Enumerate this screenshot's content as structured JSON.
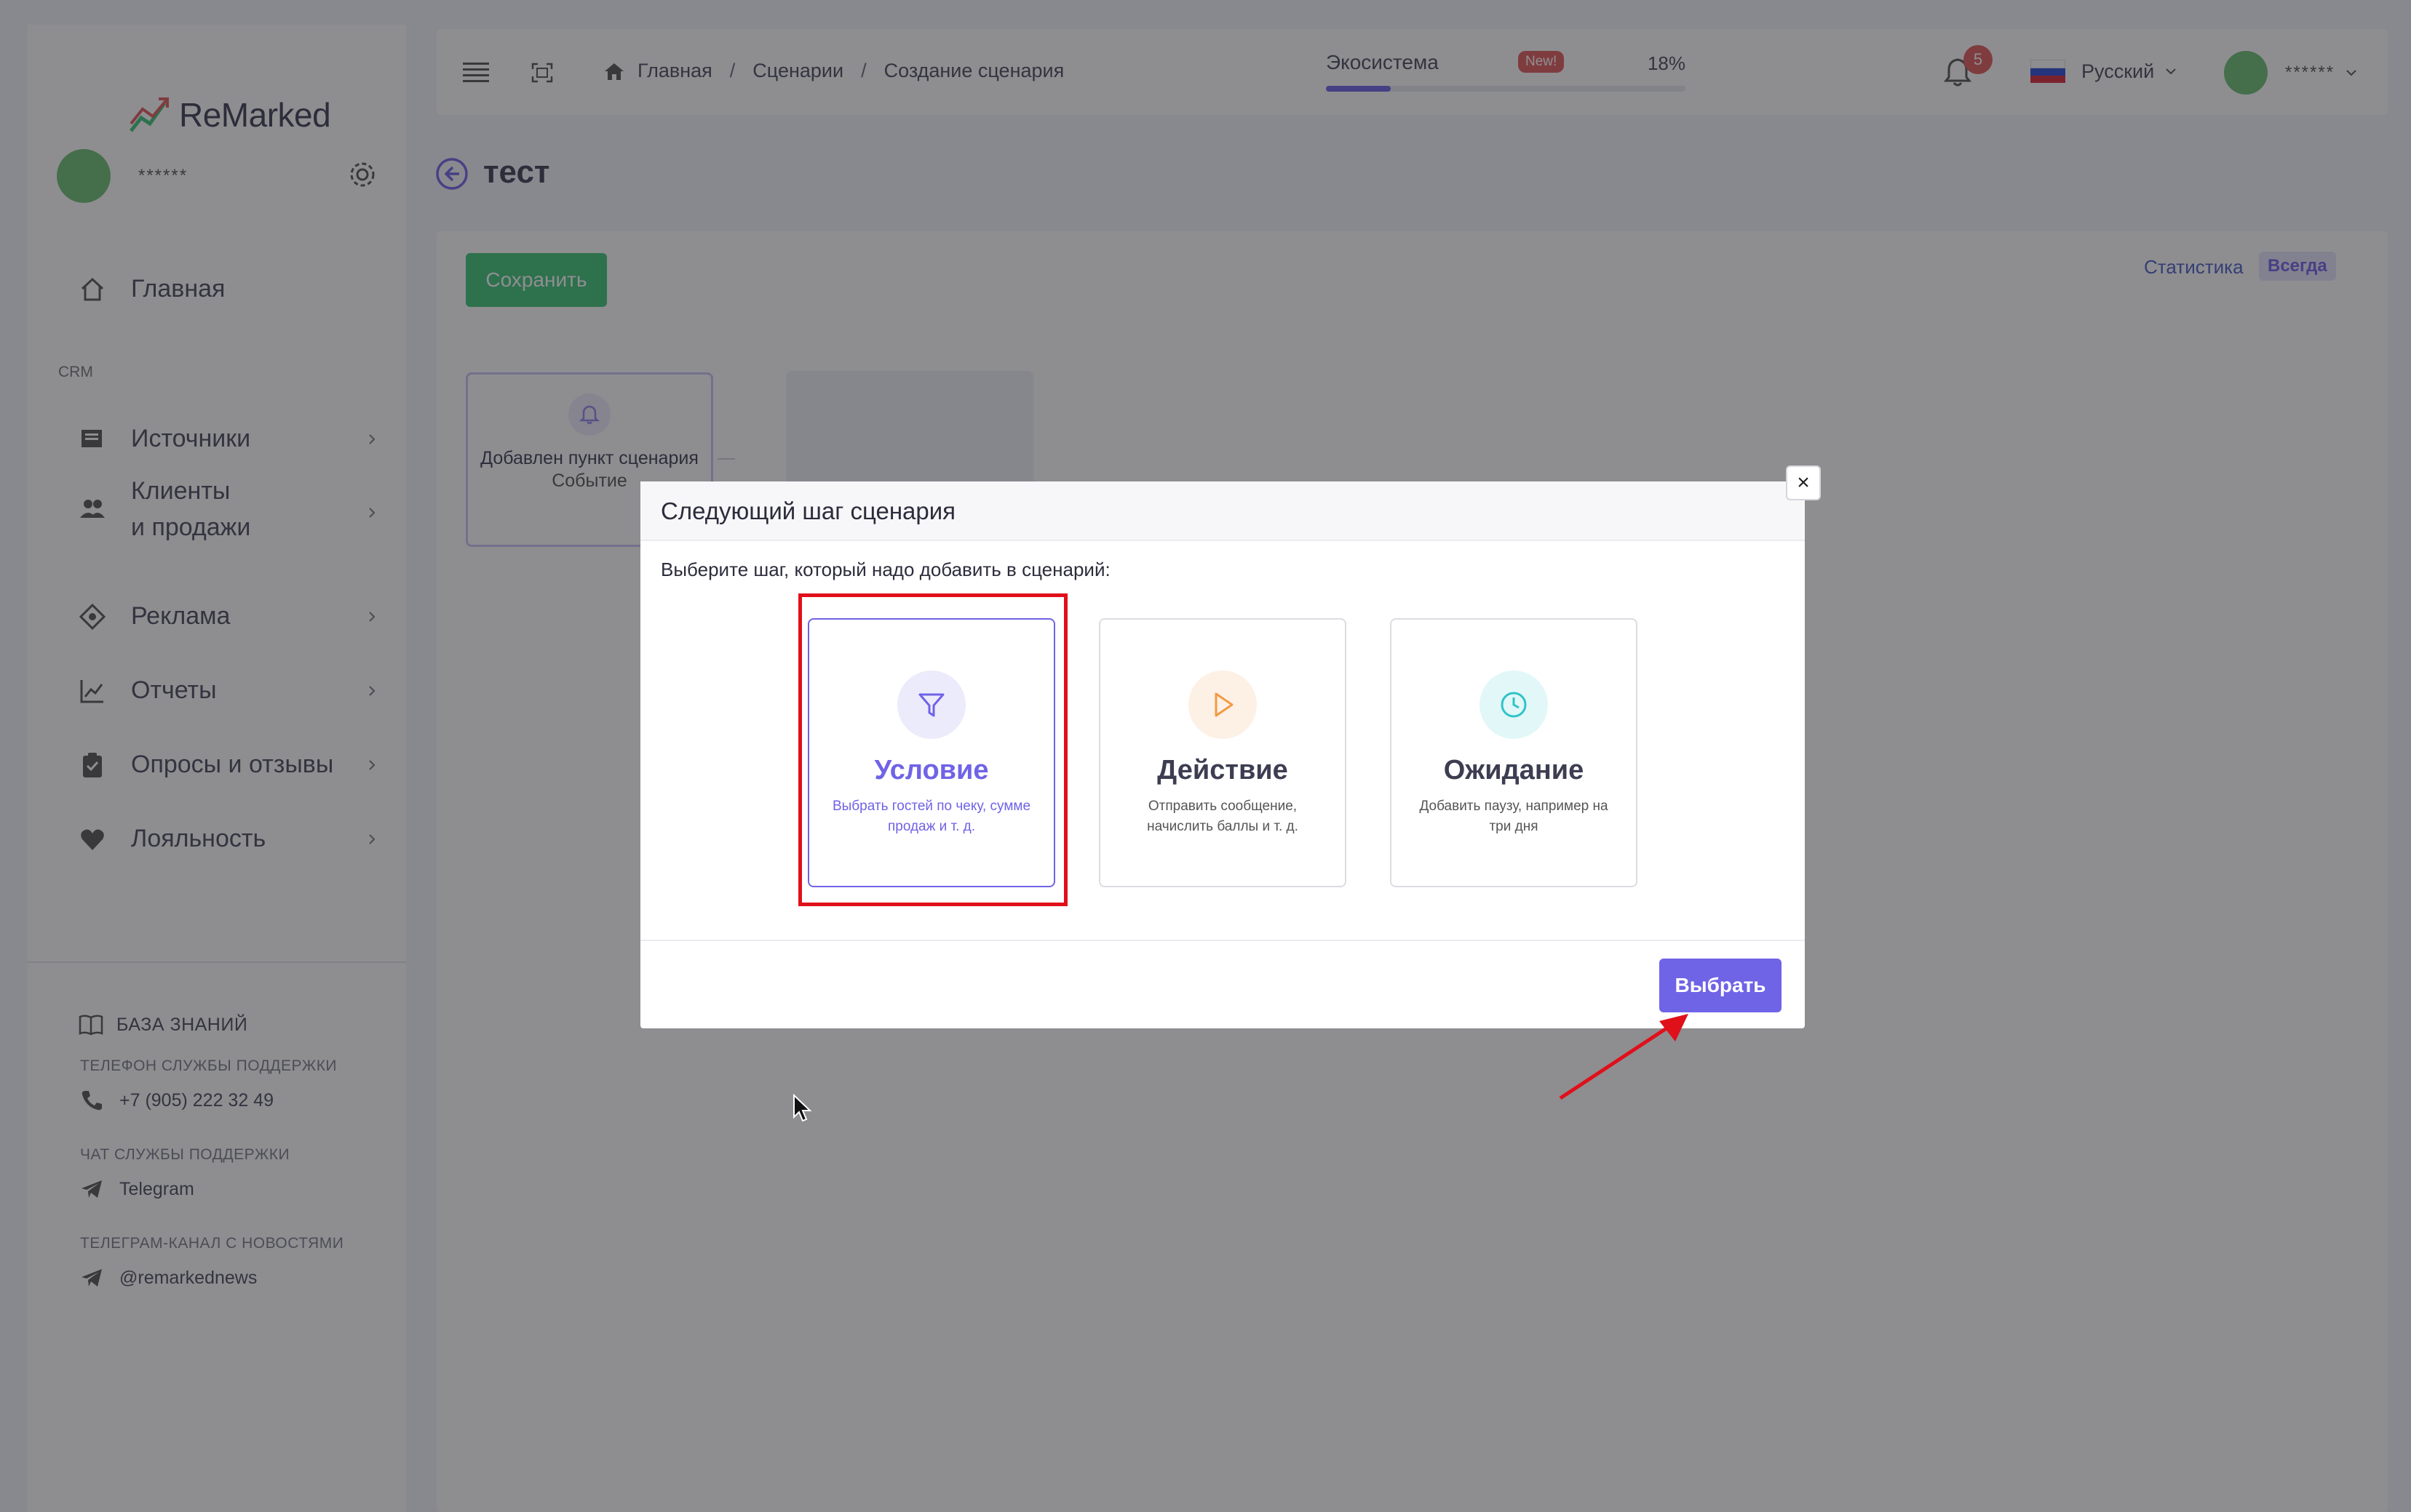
{
  "sidebar": {
    "logo_text": "ReMarked",
    "user_name": "******",
    "crm_label": "CRM",
    "items": [
      {
        "label": "Главная",
        "icon": "home-icon"
      },
      {
        "label": "Источники",
        "icon": "sources-icon"
      },
      {
        "label": "Клиенты",
        "label2": "и продажи",
        "icon": "users-icon"
      },
      {
        "label": "Реклама",
        "icon": "target-icon"
      },
      {
        "label": "Отчеты",
        "icon": "chart-icon"
      },
      {
        "label": "Опросы и отзывы",
        "icon": "clipboard-icon"
      },
      {
        "label": "Лояльность",
        "icon": "heart-icon"
      }
    ],
    "knowledge_base": "БАЗА ЗНАНИЙ",
    "support_phone_label": "ТЕЛЕФОН СЛУЖБЫ ПОДДЕРЖКИ",
    "support_phone": "+7 (905) 222 32 49",
    "support_chat_label": "ЧАТ СЛУЖБЫ ПОДДЕРЖКИ",
    "support_chat": "Telegram",
    "news_label": "ТЕЛЕГРАМ-КАНАЛ С НОВОСТЯМИ",
    "news_channel": "@remarkednews"
  },
  "topbar": {
    "breadcrumbs": [
      "Главная",
      "Сценарии",
      "Создание сценария"
    ],
    "ecosystem_label": "Экосистема",
    "ecosystem_badge": "New!",
    "ecosystem_percent": "18%",
    "ecosystem_progress": 0.18,
    "notifications_count": "5",
    "language": "Русский",
    "user_name": "******"
  },
  "page": {
    "title": "тест",
    "save_label": "Сохранить",
    "stats_label": "Статистика",
    "stats_period": "Всегда",
    "node": {
      "title": "Добавлен пункт сценария",
      "subtitle": "Событие"
    }
  },
  "modal": {
    "title": "Следующий шаг сценария",
    "close_label": "×",
    "prompt": "Выберите шаг, который надо добавить в сценарий:",
    "options": [
      {
        "title": "Условие",
        "desc": "Выбрать гостей по чеку, сумме продаж и т. д.",
        "icon": "filter-icon",
        "selected": true,
        "color": "#6f63e6"
      },
      {
        "title": "Действие",
        "desc": "Отправить сообщение, начислить баллы и т. д.",
        "icon": "play-icon",
        "selected": false,
        "color": "#f39a45"
      },
      {
        "title": "Ожидание",
        "desc": "Добавить паузу, например на три дня",
        "icon": "clock-icon",
        "selected": false,
        "color": "#2ec4c9"
      }
    ],
    "select_label": "Выбрать"
  },
  "colors": {
    "accent": "#6f63e6",
    "save_green": "#3fc477",
    "highlight_red": "#e0101a",
    "badge_red": "#e05b5b"
  }
}
